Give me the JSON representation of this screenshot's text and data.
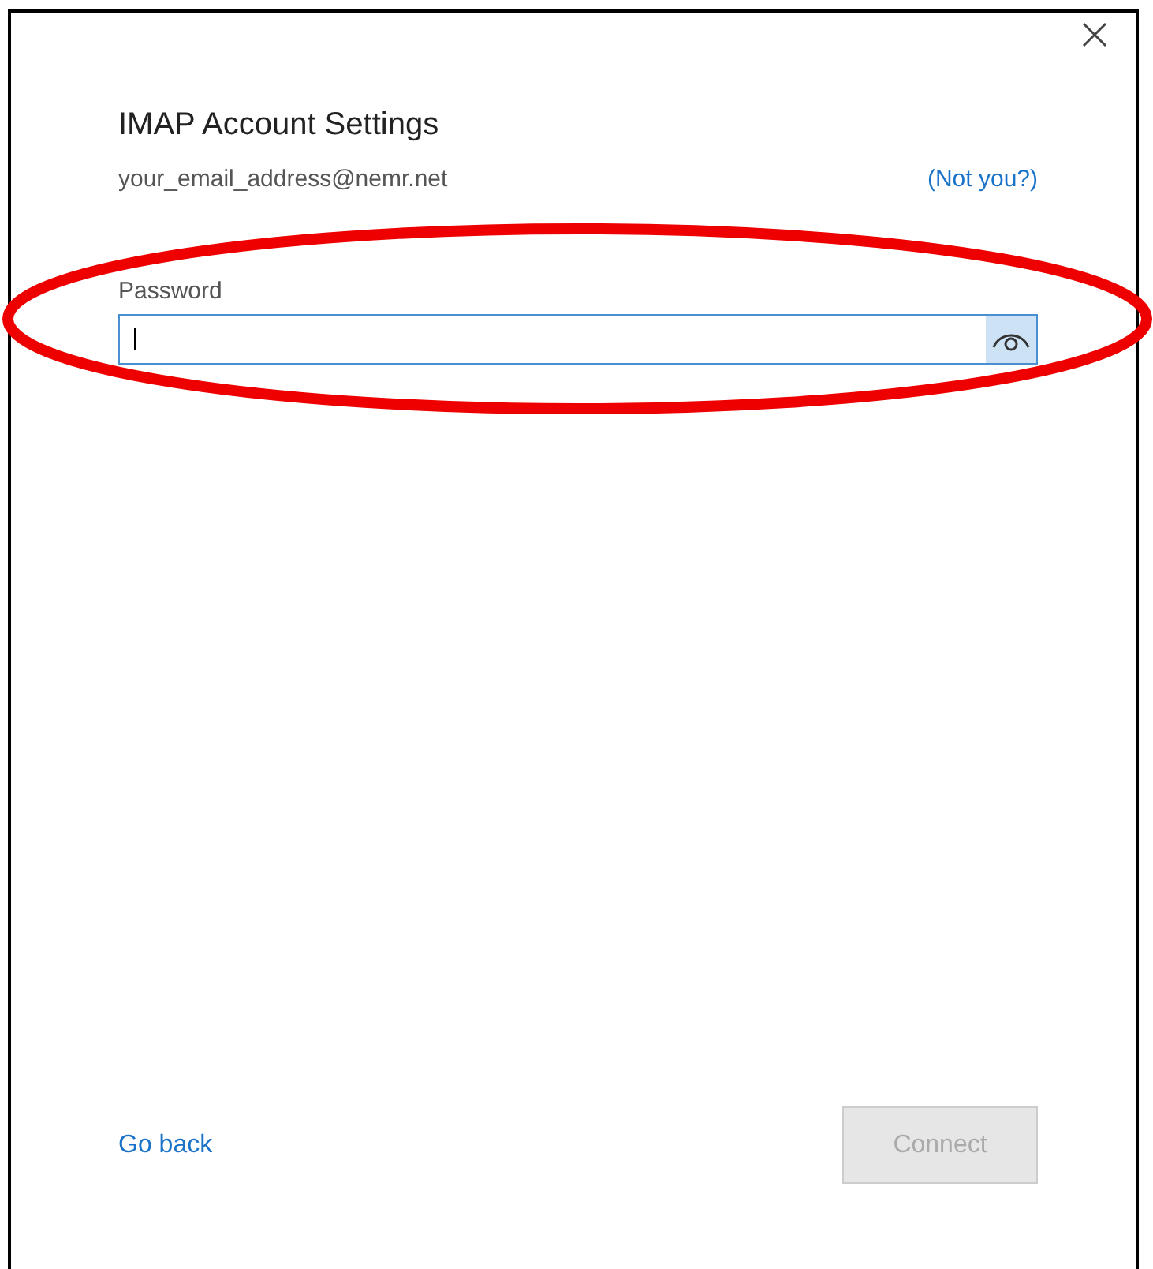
{
  "dialog": {
    "title": "IMAP Account Settings",
    "account": "your_email_address@nemr.net",
    "switch_link": "(Not you?)"
  },
  "password": {
    "label": "Password",
    "focused": true,
    "reveal_highlighted": true
  },
  "footer": {
    "back_link": "Go back",
    "connect": {
      "label": "Connect",
      "disabled": true
    }
  },
  "annotation": {
    "kind": "ellipse",
    "color": "#ee0000"
  }
}
